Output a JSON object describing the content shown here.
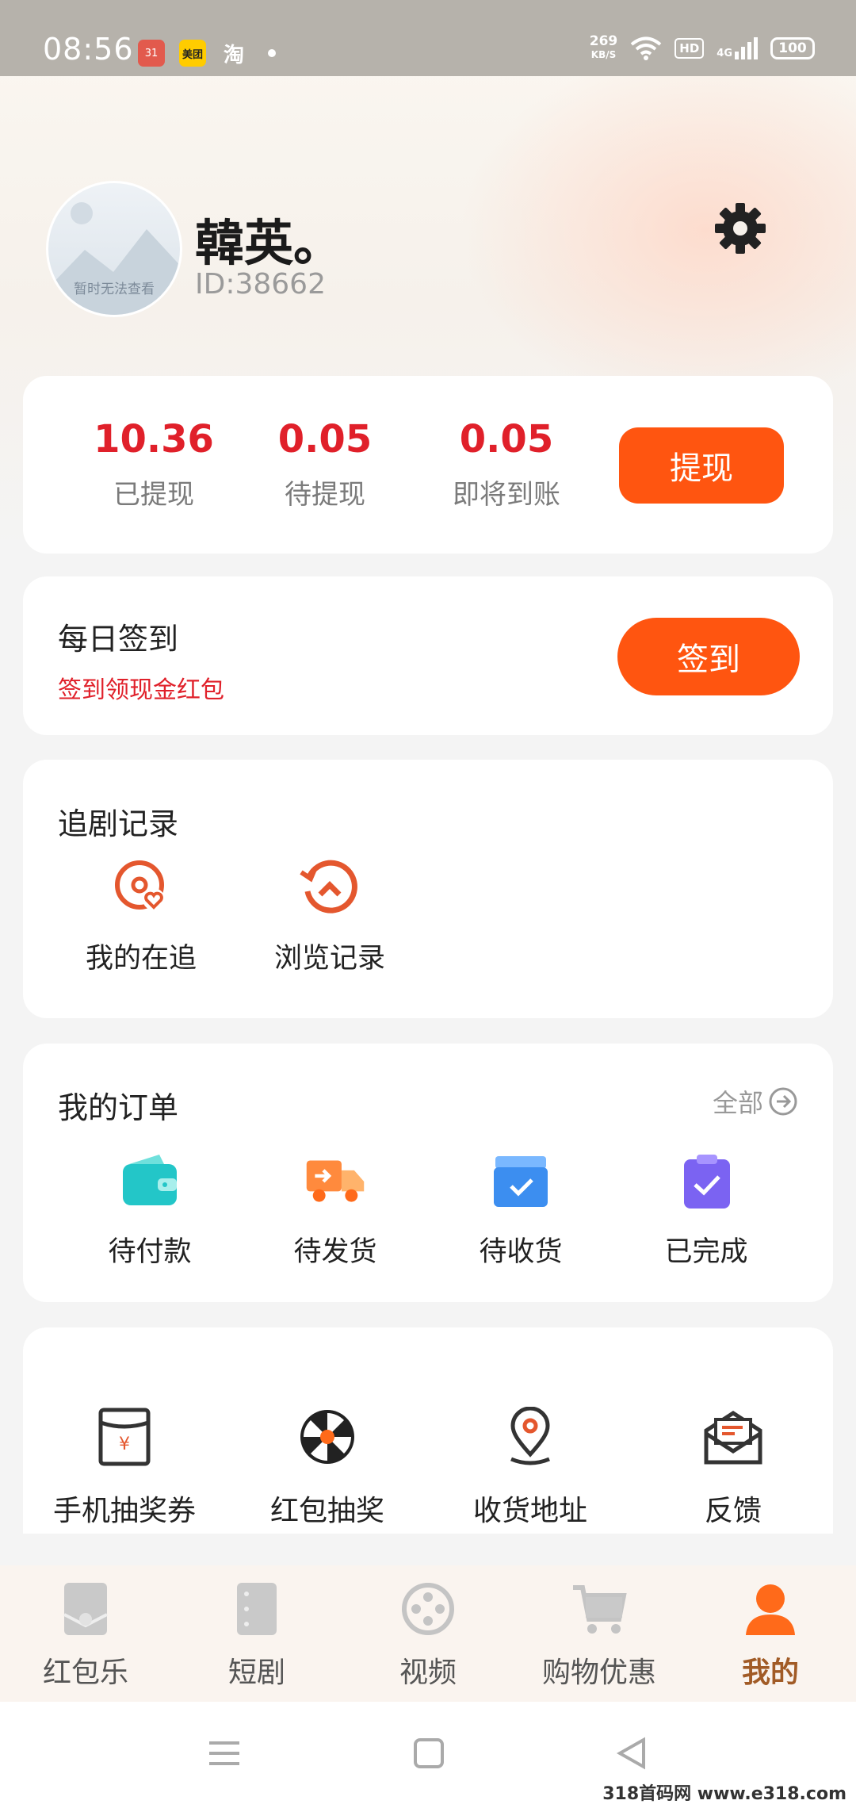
{
  "status_bar": {
    "time": "08:56",
    "apps": [
      "calendar-icon",
      "meituan-icon",
      "taobao-icon"
    ],
    "calendar_day": "31",
    "meituan_label": "美团",
    "taobao_label": "淘",
    "net_speed_value": "269",
    "net_speed_unit": "KB/S",
    "hd_label": "HD",
    "network_label": "4G",
    "battery": "100"
  },
  "profile": {
    "avatar_caption": "暂时无法查看",
    "name": "韓英。",
    "id": "ID:38662"
  },
  "wallet": {
    "stats": [
      {
        "value": "10.36",
        "label": "已提现"
      },
      {
        "value": "0.05",
        "label": "待提现"
      },
      {
        "value": "0.05",
        "label": "即将到账"
      }
    ],
    "withdraw_label": "提现"
  },
  "signin": {
    "title": "每日签到",
    "subtitle": "签到领现金红包",
    "button": "签到"
  },
  "drama_record": {
    "title": "追剧记录",
    "items": [
      {
        "label": "我的在追",
        "icon": "following-icon"
      },
      {
        "label": "浏览记录",
        "icon": "history-icon"
      }
    ]
  },
  "orders": {
    "title": "我的订单",
    "all_label": "全部",
    "items": [
      {
        "label": "待付款",
        "icon": "wallet-icon"
      },
      {
        "label": "待发货",
        "icon": "truck-icon"
      },
      {
        "label": "待收货",
        "icon": "box-icon"
      },
      {
        "label": "已完成",
        "icon": "clipboard-check-icon"
      }
    ]
  },
  "tools": {
    "items": [
      {
        "label": "手机抽奖券",
        "icon": "ticket-icon"
      },
      {
        "label": "红包抽奖",
        "icon": "wheel-icon"
      },
      {
        "label": "收货地址",
        "icon": "location-icon"
      },
      {
        "label": "反馈",
        "icon": "mail-icon"
      }
    ]
  },
  "bottom_nav": {
    "items": [
      {
        "label": "红包乐",
        "icon": "envelope-icon"
      },
      {
        "label": "短剧",
        "icon": "drama-icon"
      },
      {
        "label": "视频",
        "icon": "video-icon"
      },
      {
        "label": "购物优惠",
        "icon": "cart-icon"
      },
      {
        "label": "我的",
        "icon": "user-icon"
      }
    ],
    "active": "我的"
  },
  "watermark": "318首码网 www.e318.com",
  "colors": {
    "accent": "#ff5510",
    "money_red": "#e0202a",
    "active_tab": "#a15b26"
  }
}
